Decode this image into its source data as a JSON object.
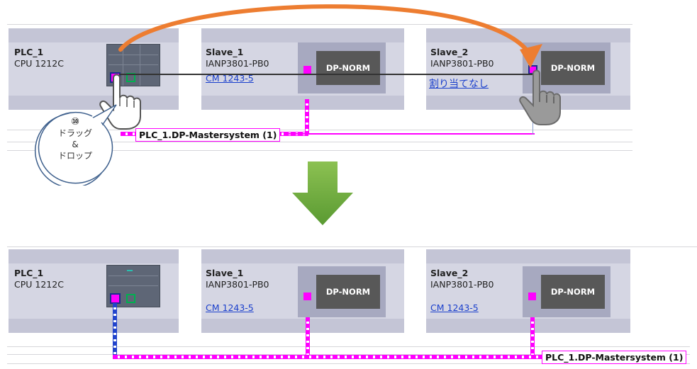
{
  "top": {
    "plc": {
      "name": "PLC_1",
      "type": "CPU 1212C"
    },
    "slave1": {
      "name": "Slave_1",
      "type": "IANP3801-PB0",
      "link": "CM 1243-5",
      "dp": "DP-NORM"
    },
    "slave2": {
      "name": "Slave_2",
      "type": "IANP3801-PB0",
      "link": "割り当てなし",
      "dp": "DP-NORM"
    },
    "network_label": "PLC_1.DP-Mastersystem (1)"
  },
  "callout": {
    "number": "⑩",
    "line1": "ドラッグ",
    "line2": "&",
    "line3": "ドロップ"
  },
  "bottom": {
    "plc": {
      "name": "PLC_1",
      "type": "CPU 1212C"
    },
    "slave1": {
      "name": "Slave_1",
      "type": "IANP3801-PB0",
      "link": "CM 1243-5",
      "dp": "DP-NORM"
    },
    "slave2": {
      "name": "Slave_2",
      "type": "IANP3801-PB0",
      "link": "CM 1243-5",
      "dp": "DP-NORM"
    },
    "network_label": "PLC_1.DP-Mastersystem (1)"
  },
  "colors": {
    "profibus": "#ff00ff",
    "arrow_orange": "#ed7d31",
    "arrow_green": "#70ad47",
    "link": "#1a3fcc"
  },
  "icons": [
    "hand-pointer-icon",
    "hand-drop-icon",
    "curved-arrow-icon",
    "down-arrow-icon"
  ]
}
